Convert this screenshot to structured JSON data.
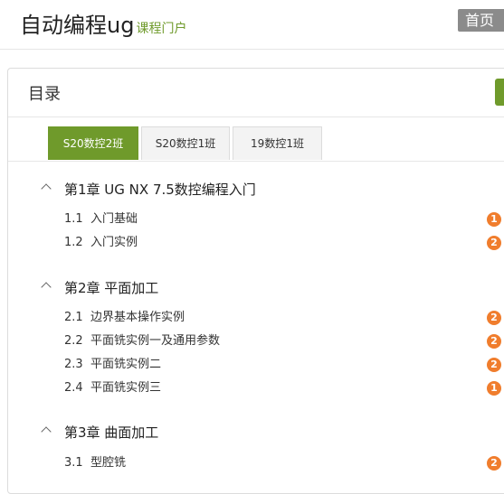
{
  "site": {
    "title": "自动编程ug",
    "subtitle": "课程门户",
    "home_label": "首页"
  },
  "panel": {
    "title": "目录"
  },
  "tabs": [
    {
      "label": "S20数控2班",
      "active": true
    },
    {
      "label": "S20数控1班",
      "active": false
    },
    {
      "label": "19数控1班",
      "active": false
    }
  ],
  "chapters": [
    {
      "title": "第1章 UG NX 7.5数控编程入门",
      "lessons": [
        {
          "num": "1.1",
          "title": "入门基础",
          "badge": "1"
        },
        {
          "num": "1.2",
          "title": "入门实例",
          "badge": "2"
        }
      ]
    },
    {
      "title": "第2章 平面加工",
      "lessons": [
        {
          "num": "2.1",
          "title": "边界基本操作实例",
          "badge": "2"
        },
        {
          "num": "2.2",
          "title": "平面铣实例一及通用参数",
          "badge": "2"
        },
        {
          "num": "2.3",
          "title": "平面铣实例二",
          "badge": "2"
        },
        {
          "num": "2.4",
          "title": "平面铣实例三",
          "badge": "1"
        }
      ]
    },
    {
      "title": "第3章 曲面加工",
      "lessons": [
        {
          "num": "3.1",
          "title": "型腔铣",
          "badge": "2"
        }
      ]
    }
  ],
  "colors": {
    "accent": "#6f9a2b",
    "badge": "#f07d2d",
    "home_button": "#8b8b8b"
  }
}
